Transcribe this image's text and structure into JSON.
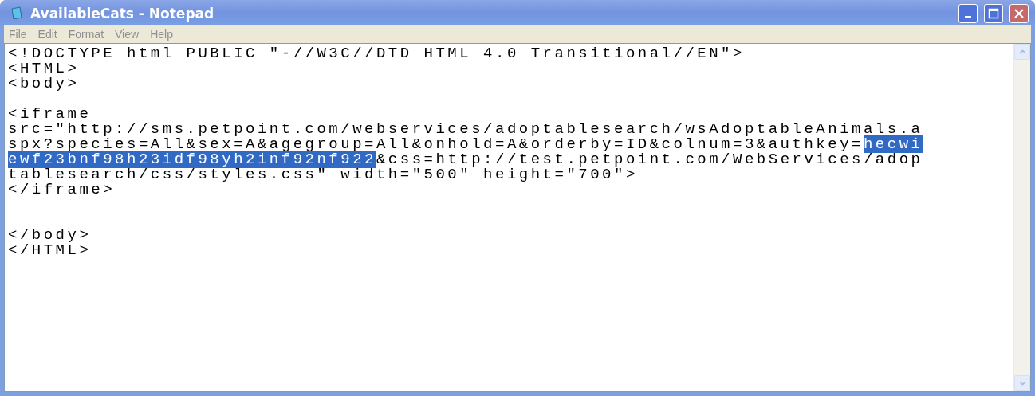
{
  "window": {
    "title": "AvailableCats - Notepad"
  },
  "menu": [
    "File",
    "Edit",
    "Format",
    "View",
    "Help"
  ],
  "editor": {
    "lines": [
      {
        "kind": "text",
        "segments": [
          {
            "text": "<!DOCTYPE html PUBLIC \"-//W3C//DTD HTML 4.0 Transitional//EN\">",
            "selected": false
          }
        ]
      },
      {
        "kind": "text",
        "segments": [
          {
            "text": "<HTML>",
            "selected": false
          }
        ]
      },
      {
        "kind": "text",
        "segments": [
          {
            "text": "<body>",
            "selected": false
          }
        ]
      },
      {
        "kind": "blank"
      },
      {
        "kind": "text",
        "segments": [
          {
            "text": "<iframe",
            "selected": false
          }
        ]
      },
      {
        "kind": "text",
        "segments": [
          {
            "text": "src=\"http://sms.petpoint.com/webservices/adoptablesearch/wsAdoptableAnimals.a",
            "selected": false
          }
        ]
      },
      {
        "kind": "text",
        "segments": [
          {
            "text": "spx?species=All&sex=A&agegroup=All&onhold=A&orderby=ID&colnum=3&authkey=",
            "selected": false
          },
          {
            "text": "hecwi",
            "selected": true
          }
        ]
      },
      {
        "kind": "text",
        "segments": [
          {
            "text": "ewf23bnf98h23idf98yh2inf92nf922",
            "selected": true
          },
          {
            "text": "&css=http://test.petpoint.com/WebServices/adop",
            "selected": false
          }
        ]
      },
      {
        "kind": "text",
        "segments": [
          {
            "text": "tablesearch/css/styles.css\" width=\"500\" height=\"700\">",
            "selected": false
          }
        ]
      },
      {
        "kind": "text",
        "segments": [
          {
            "text": "</iframe>",
            "selected": false
          }
        ]
      },
      {
        "kind": "blank"
      },
      {
        "kind": "blank"
      },
      {
        "kind": "text",
        "segments": [
          {
            "text": "</body>",
            "selected": false
          }
        ]
      },
      {
        "kind": "text",
        "segments": [
          {
            "text": "</HTML>",
            "selected": false
          }
        ]
      }
    ]
  }
}
